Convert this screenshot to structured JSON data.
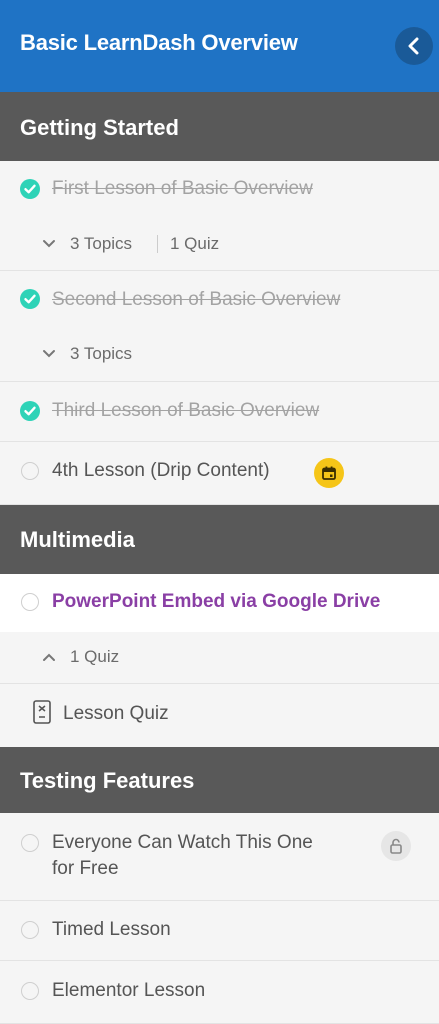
{
  "header": {
    "title": "Basic LearnDash Overview",
    "back_icon": "chevron-left-icon"
  },
  "sections": [
    {
      "title": "Getting Started"
    },
    {
      "title": "Multimedia"
    },
    {
      "title": "Testing Features"
    }
  ],
  "lessons": {
    "l1": {
      "label": "First Lesson of Basic Overview",
      "status": "complete",
      "topics": "3 Topics",
      "quizzes": "1 Quiz"
    },
    "l2": {
      "label": "Second Lesson of Basic Overview",
      "status": "complete",
      "topics": "3 Topics"
    },
    "l3": {
      "label": "Third Lesson of Basic Overview",
      "status": "complete"
    },
    "l4": {
      "label": "4th Lesson (Drip Content)",
      "status": "incomplete",
      "badge_icon": "calendar-icon"
    },
    "l5": {
      "label": "PowerPoint Embed via Google Drive",
      "status": "current",
      "quizzes": "1 Quiz"
    },
    "quiz": {
      "label": "Lesson Quiz",
      "icon": "quiz-icon"
    },
    "l6": {
      "label": "Everyone Can Watch This One for Free",
      "line1": "Everyone Can Watch This One",
      "line2": "for Free",
      "status": "incomplete",
      "badge_icon": "unlock-icon"
    },
    "l7": {
      "label": "Timed Lesson",
      "status": "incomplete"
    },
    "l8": {
      "label": "Elementor Lesson",
      "status": "incomplete"
    }
  },
  "colors": {
    "header": "#1f73c5",
    "section": "#595959",
    "check": "#2ed3b7",
    "current": "#8a3fa5",
    "drip": "#f5c518"
  }
}
